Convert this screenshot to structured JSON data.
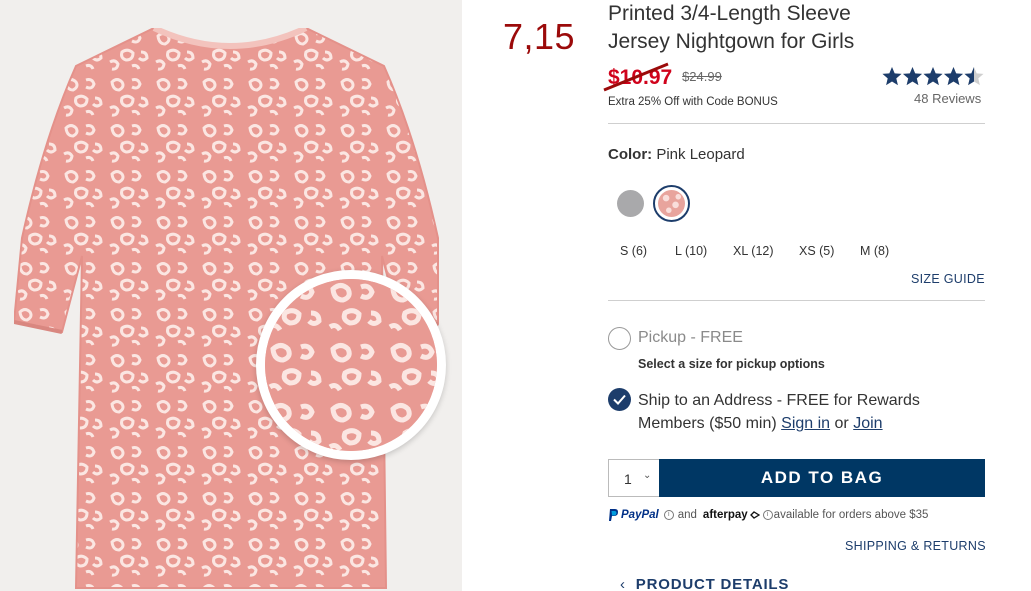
{
  "promo_overlay": {
    "price": "7,15"
  },
  "product": {
    "title_line1": "Printed 3/4-Length Sleeve",
    "title_line2": "Jersey Nightgown for Girls",
    "sale_price": "$10.97",
    "original_price": "$24.99",
    "promo_text": "Extra 25% Off with Code BONUS",
    "rating": 4.5,
    "rating_max": 5,
    "reviews": "48 Reviews",
    "image_alt": "pink-leopard-nightgown"
  },
  "color": {
    "label": "Color:",
    "value": "Pink Leopard",
    "swatches": [
      {
        "name": "gray",
        "hex": "#a9a9ab"
      },
      {
        "name": "pink-leopard",
        "hex": "#e8a49d",
        "selected": true
      }
    ]
  },
  "sizes": [
    "S (6)",
    "L (10)",
    "XL (12)",
    "XS (5)",
    "M (8)"
  ],
  "size_guide": "SIZE GUIDE",
  "fulfillment": {
    "pickup_label": "Pickup - FREE",
    "pickup_note": "Select a size for pickup options",
    "ship_text_1": "Ship to an Address - FREE for Rewards",
    "ship_text_2": "Members ($50 min)",
    "sign_in": "Sign in",
    "or": "or",
    "join": "Join"
  },
  "cart": {
    "quantity": "1",
    "add_to_bag": "ADD TO BAG"
  },
  "payment": {
    "paypal": "PayPal",
    "and": "and",
    "afterpay": "afterpay",
    "availability": "available for orders above $35"
  },
  "shipping_returns": "SHIPPING & RETURNS",
  "product_details": "PRODUCT DETAILS",
  "colors": {
    "navy": "#003764",
    "sale_red": "#d0021b",
    "promo_red": "#9b0a0a",
    "pink": "#e89a93"
  }
}
